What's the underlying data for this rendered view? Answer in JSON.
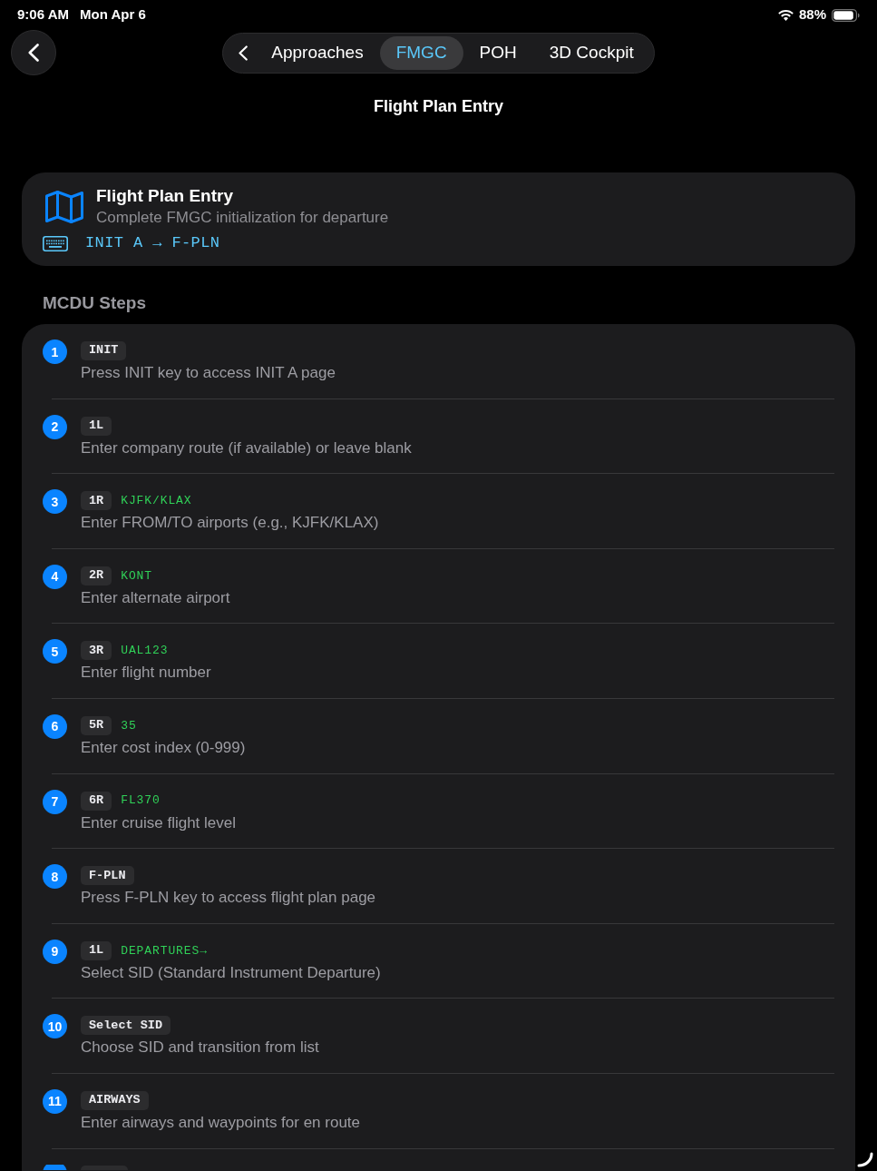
{
  "status_bar": {
    "time": "9:06 AM",
    "date": "Mon Apr 6",
    "battery": "88%"
  },
  "nav": {
    "tabs": [
      {
        "label": "Approaches",
        "selected": false
      },
      {
        "label": "FMGC",
        "selected": true
      },
      {
        "label": "POH",
        "selected": false
      },
      {
        "label": "3D Cockpit",
        "selected": false
      }
    ]
  },
  "page_title": "Flight Plan Entry",
  "header_card": {
    "title": "Flight Plan Entry",
    "subtitle": "Complete FMGC initialization for departure",
    "sequence": "INIT A → F-PLN"
  },
  "steps_section": {
    "title": "MCDU Steps",
    "steps": [
      {
        "number": "1",
        "key": "INIT",
        "description": "Press INIT key to access INIT A page"
      },
      {
        "number": "2",
        "key": "1L",
        "description": "Enter company route (if available) or leave blank"
      },
      {
        "number": "3",
        "key": "1R",
        "value": "KJFK/KLAX",
        "description": "Enter FROM/TO airports (e.g., KJFK/KLAX)"
      },
      {
        "number": "4",
        "key": "2R",
        "value": "KONT",
        "description": "Enter alternate airport"
      },
      {
        "number": "5",
        "key": "3R",
        "value": "UAL123",
        "description": "Enter flight number"
      },
      {
        "number": "6",
        "key": "5R",
        "value": "35",
        "description": "Enter cost index (0-999)"
      },
      {
        "number": "7",
        "key": "6R",
        "value": "FL370",
        "description": "Enter cruise flight level"
      },
      {
        "number": "8",
        "key": "F-PLN",
        "description": "Press F-PLN key to access flight plan page"
      },
      {
        "number": "9",
        "key": "1L",
        "value": "DEPARTURES→",
        "description": "Select SID (Standard Instrument Departure)"
      },
      {
        "number": "10",
        "key": "Select SID",
        "description": "Choose SID and transition from list"
      },
      {
        "number": "11",
        "key": "AIRWAYS",
        "description": "Enter airways and waypoints for en route"
      }
    ],
    "more_steps_below": true
  }
}
